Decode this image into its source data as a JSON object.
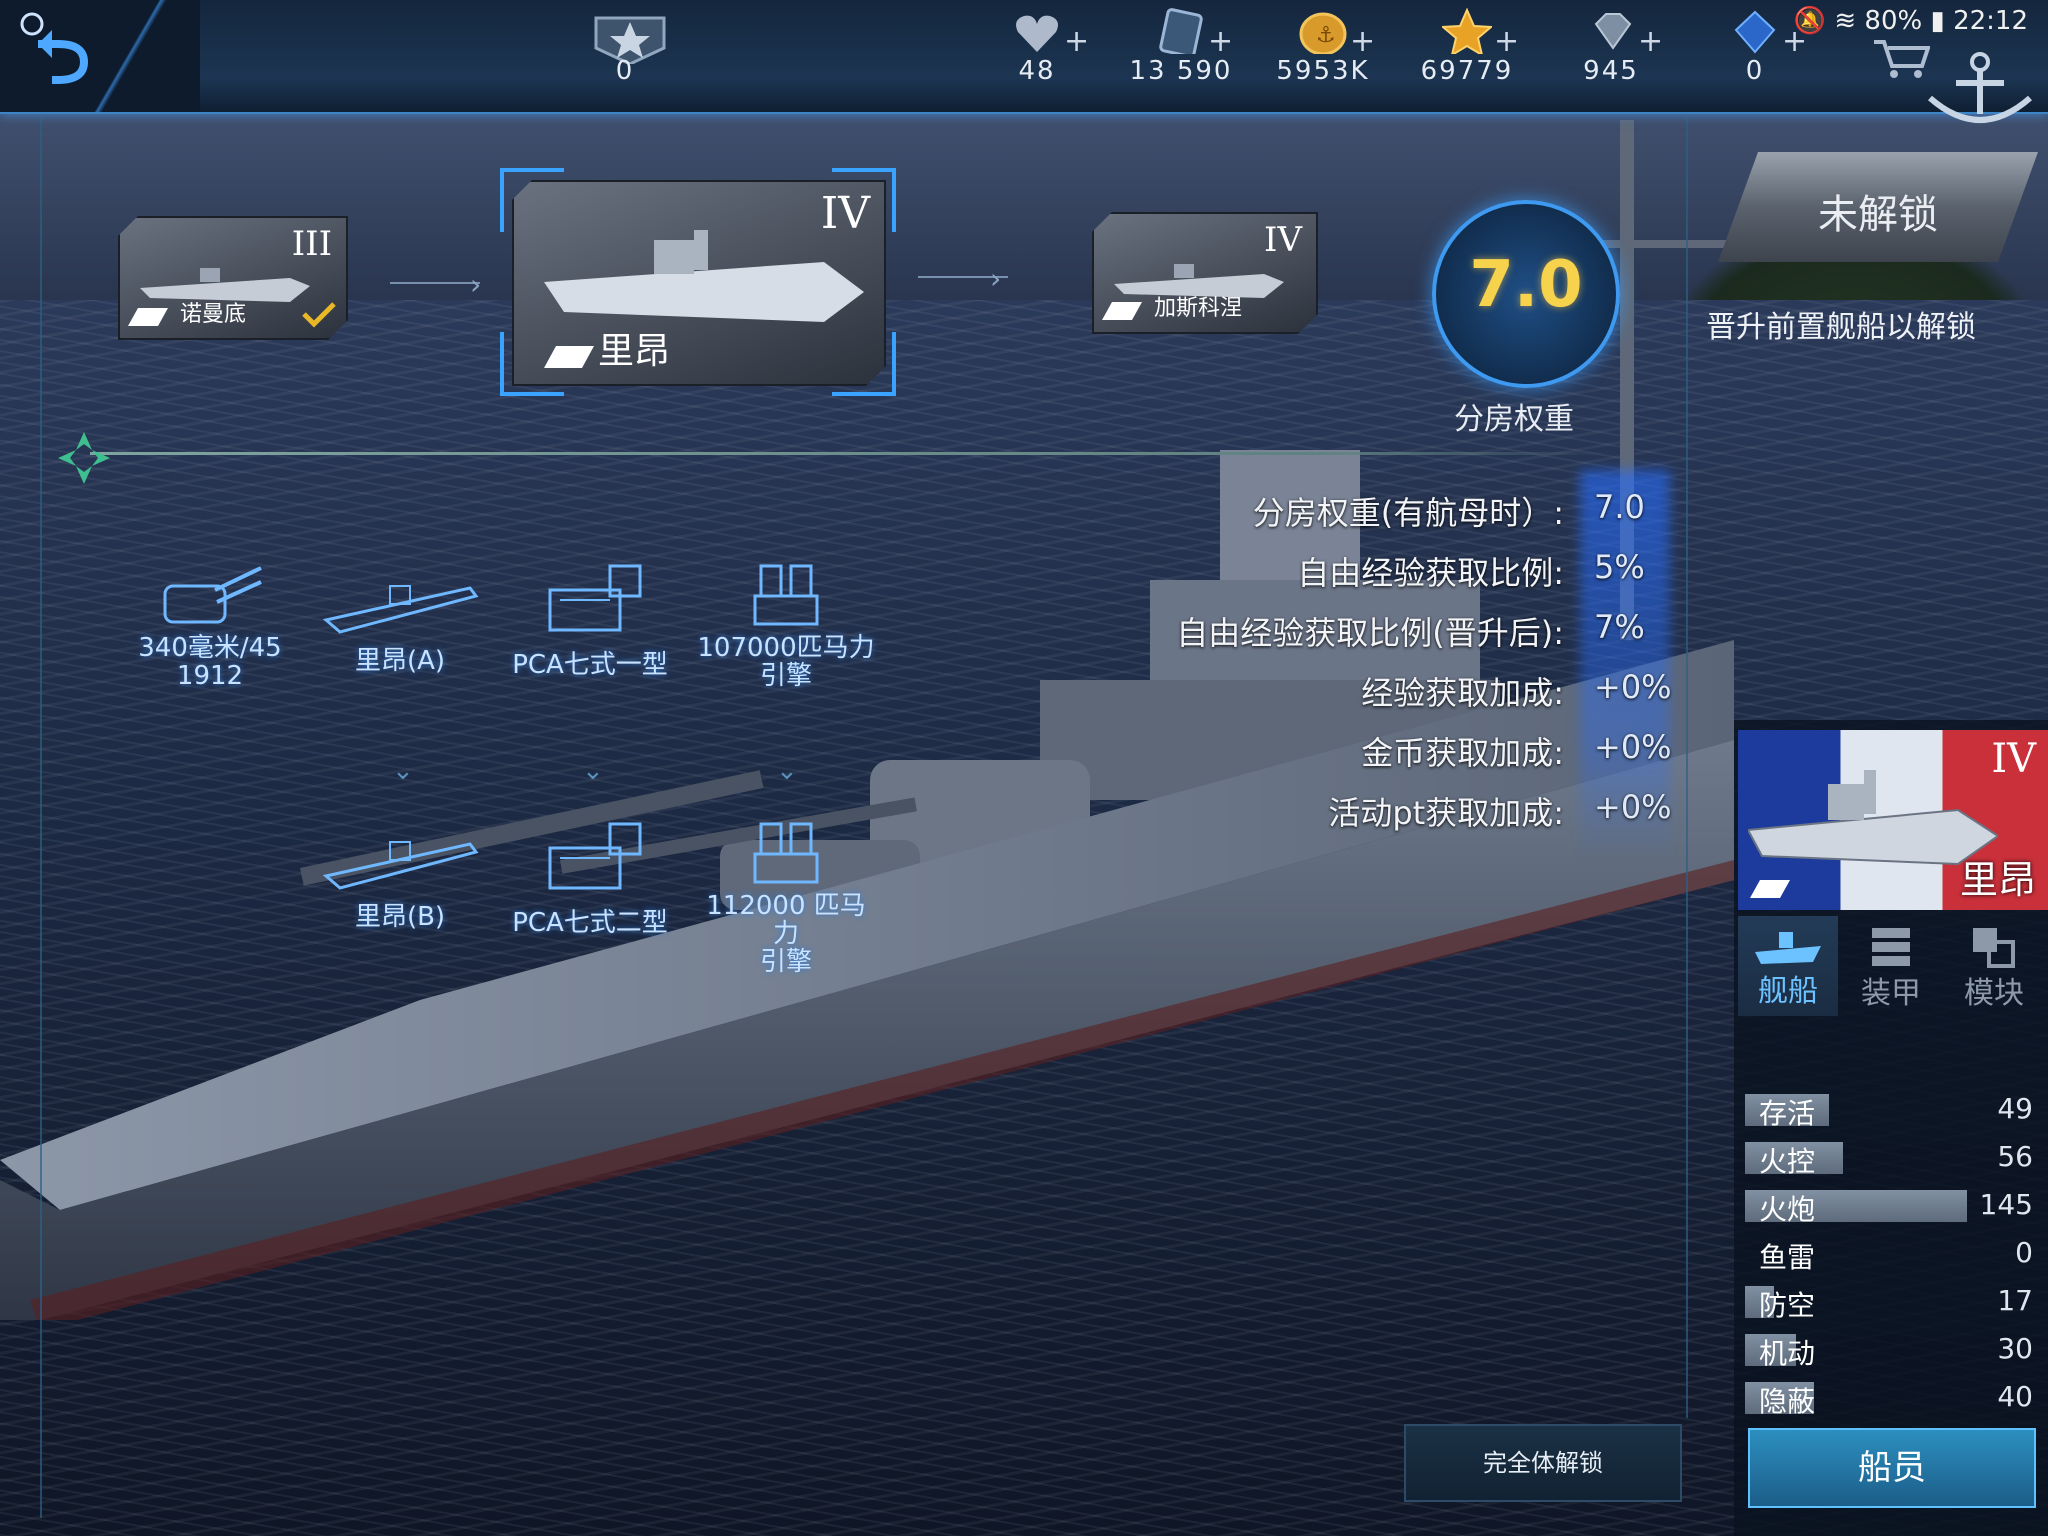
{
  "topbar": {
    "resources": [
      {
        "icon": "rank-star-icon",
        "value": "0",
        "plus": ""
      },
      {
        "icon": "heart-icon",
        "value": "48",
        "plus": "+"
      },
      {
        "icon": "blueprint-icon",
        "value": "13 590",
        "plus": "+"
      },
      {
        "icon": "gold-coin-icon",
        "value": "5953K",
        "plus": "+"
      },
      {
        "icon": "gold-star-icon",
        "value": "69779",
        "plus": "+"
      },
      {
        "icon": "diamond-icon",
        "value": "945",
        "plus": "+"
      },
      {
        "icon": "blue-gem-icon",
        "value": "0",
        "plus": "+"
      }
    ],
    "status": {
      "battery": "80%",
      "time": "22:12"
    }
  },
  "tree": {
    "prev": {
      "tier": "III",
      "name": "诺曼底"
    },
    "current": {
      "tier": "IV",
      "name": "里昂"
    },
    "next": {
      "tier": "IV",
      "name": "加斯科涅"
    }
  },
  "rating": {
    "value": "7.0",
    "label": "分房权重"
  },
  "unlock": {
    "button": "未解锁",
    "hint": "晋升前置舰船以解锁"
  },
  "stats": [
    {
      "label": "分房权重(有航母时）:",
      "value": "7.0"
    },
    {
      "label": "自由经验获取比例:",
      "value": "5%"
    },
    {
      "label": "自由经验获取比例(晋升后):",
      "value": "7%"
    },
    {
      "label": "经验获取加成:",
      "value": "+0%"
    },
    {
      "label": "金币获取加成:",
      "value": "+0%"
    },
    {
      "label": "活动pt获取加成:",
      "value": "+0%"
    }
  ],
  "modules": {
    "row1": [
      {
        "name": "340毫米/45\n1912",
        "icon": "main-gun-icon"
      },
      {
        "name": "里昂(A)",
        "icon": "hull-icon"
      },
      {
        "name": "PCA七式一型",
        "icon": "fire-control-icon"
      },
      {
        "name": "107000匹马力\n引擎",
        "icon": "engine-icon"
      }
    ],
    "row2": [
      {
        "name": "里昂(B)",
        "icon": "hull-icon"
      },
      {
        "name": "PCA七式二型",
        "icon": "fire-control-icon"
      },
      {
        "name": "112000 匹马力\n引擎",
        "icon": "engine-icon"
      }
    ]
  },
  "panel": {
    "tier": "IV",
    "name": "里昂",
    "tabs": [
      "舰船",
      "装甲",
      "模块"
    ],
    "stats": [
      {
        "label": "存活",
        "value": "49",
        "ratio": 0.38
      },
      {
        "label": "火控",
        "value": "56",
        "ratio": 0.44
      },
      {
        "label": "火炮",
        "value": "145",
        "ratio": 1.0
      },
      {
        "label": "鱼雷",
        "value": "0",
        "ratio": 0.0
      },
      {
        "label": "防空",
        "value": "17",
        "ratio": 0.13
      },
      {
        "label": "机动",
        "value": "30",
        "ratio": 0.23
      },
      {
        "label": "隐蔽",
        "value": "40",
        "ratio": 0.31
      }
    ],
    "crew_button": "船员"
  },
  "full_unlock_button": "完全体解锁",
  "colors": {
    "accent": "#3aa3ff",
    "rating": "#f7d24c",
    "panel_bar": "#7a899b"
  }
}
